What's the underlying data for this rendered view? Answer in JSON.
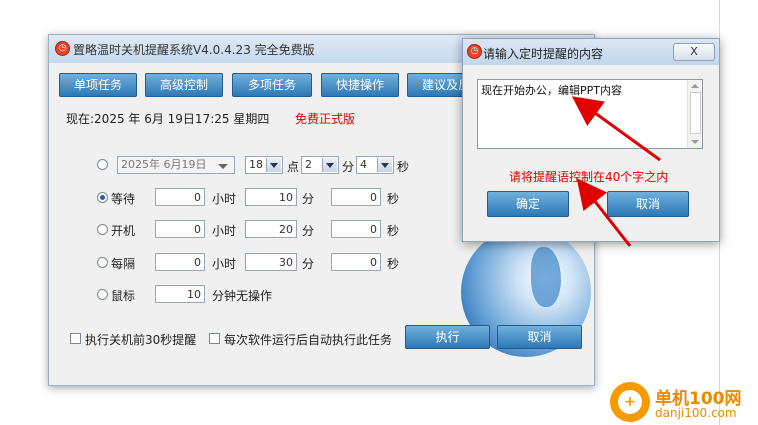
{
  "main_window": {
    "title": "置略温时关机提醒系统V4.0.4.23 完全免费版",
    "toolbar": [
      "单项任务",
      "高级控制",
      "多项任务",
      "快捷操作",
      "建议及反"
    ],
    "status": {
      "now_label": "现在:2025 年  6月 19日17:25  星期四",
      "edition": "免费正式版"
    },
    "schedule": {
      "date_value": "2025年 6月19日",
      "hour": "18",
      "hour_unit": "点",
      "minute": "2",
      "minute_unit": "分",
      "second": "4",
      "second_unit": "秒"
    },
    "rows": [
      {
        "label": "等待",
        "hours": "0",
        "minutes": "10",
        "seconds": "0",
        "selected": true
      },
      {
        "label": "开机",
        "hours": "0",
        "minutes": "20",
        "seconds": "0",
        "selected": false
      },
      {
        "label": "每隔",
        "hours": "0",
        "minutes": "30",
        "seconds": "0",
        "selected": false
      }
    ],
    "unit_labels": {
      "hours": "小时",
      "minutes": "分",
      "seconds": "秒"
    },
    "mouse_row": {
      "label": "鼠标",
      "value": "10",
      "suffix": "分钟无操作"
    },
    "options": {
      "remind_30s": "执行关机前30秒提醒",
      "auto_run": "每次软件运行后自动执行此任务"
    },
    "execute_label": "执行",
    "cancel_label": "取消"
  },
  "dialog": {
    "title": "请输入定时提醒的内容",
    "close_label": "X",
    "input_value": "现在开始办公，编辑PPT内容",
    "hint": "请将提醒语控制在40个字之内",
    "ok_label": "确定",
    "cancel_label": "取消"
  },
  "watermark": {
    "name": "单机100网",
    "url": "danji100.com"
  },
  "colors": {
    "accent": "#2d78b5",
    "warning": "#e00000",
    "annotation": "#e00000",
    "watermark": "#e98a00"
  }
}
